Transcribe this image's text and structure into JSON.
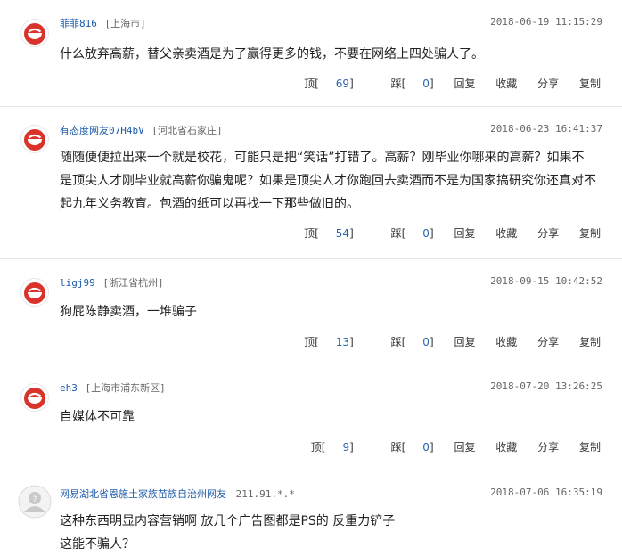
{
  "comments": [
    {
      "user": "菲菲816",
      "location": "[上海市]",
      "time": "2018-06-19 11:15:29",
      "lines": [
        "什么放弃高薪，替父亲卖酒是为了赢得更多的钱，不要在网络上四处骗人了。"
      ],
      "up": "69",
      "down": "0",
      "avatar_icon": "netease-red-avatar-icon"
    },
    {
      "user": "有态度网友07H4bV",
      "location": "[河北省石家庄]",
      "time": "2018-06-23 16:41:37",
      "lines": [
        "随随便便拉出来一个就是校花，可能只是把“笑话”打错了。高薪？刚毕业你哪来的高薪？如果不",
        "是顶尖人才刚毕业就高薪你骗鬼呢？如果是顶尖人才你跑回去卖酒而不是为国家搞研究你还真对不",
        "起九年义务教育。包酒的纸可以再找一下那些做旧的。"
      ],
      "up": "54",
      "down": "0",
      "avatar_icon": "netease-red-avatar-icon"
    },
    {
      "user": "ligj99",
      "location": "[浙江省杭州]",
      "time": "2018-09-15 10:42:52",
      "lines": [
        "狗屁陈静卖酒，一堆骗子"
      ],
      "up": "13",
      "down": "0",
      "avatar_icon": "netease-red-avatar-icon"
    },
    {
      "user": "eh3",
      "location": "[上海市浦东新区]",
      "time": "2018-07-20 13:26:25",
      "lines": [
        "自媒体不可靠"
      ],
      "up": "9",
      "down": "0",
      "avatar_icon": "netease-red-avatar-icon"
    },
    {
      "user": "网易湖北省恩施土家族苗族自治州网友",
      "ip": "211.91.*.*",
      "time": "2018-07-06 16:35:19",
      "lines": [
        "这种东西明显内容营销啊 放几个广告图都是PS的 反重力铲子",
        "这能不骗人？"
      ],
      "avatar_icon": "anonymous-grey-avatar-icon"
    }
  ],
  "labels": {
    "up": "顶",
    "down": "踩",
    "reply": "回复",
    "favorite": "收藏",
    "share": "分享",
    "copy": "复制"
  }
}
